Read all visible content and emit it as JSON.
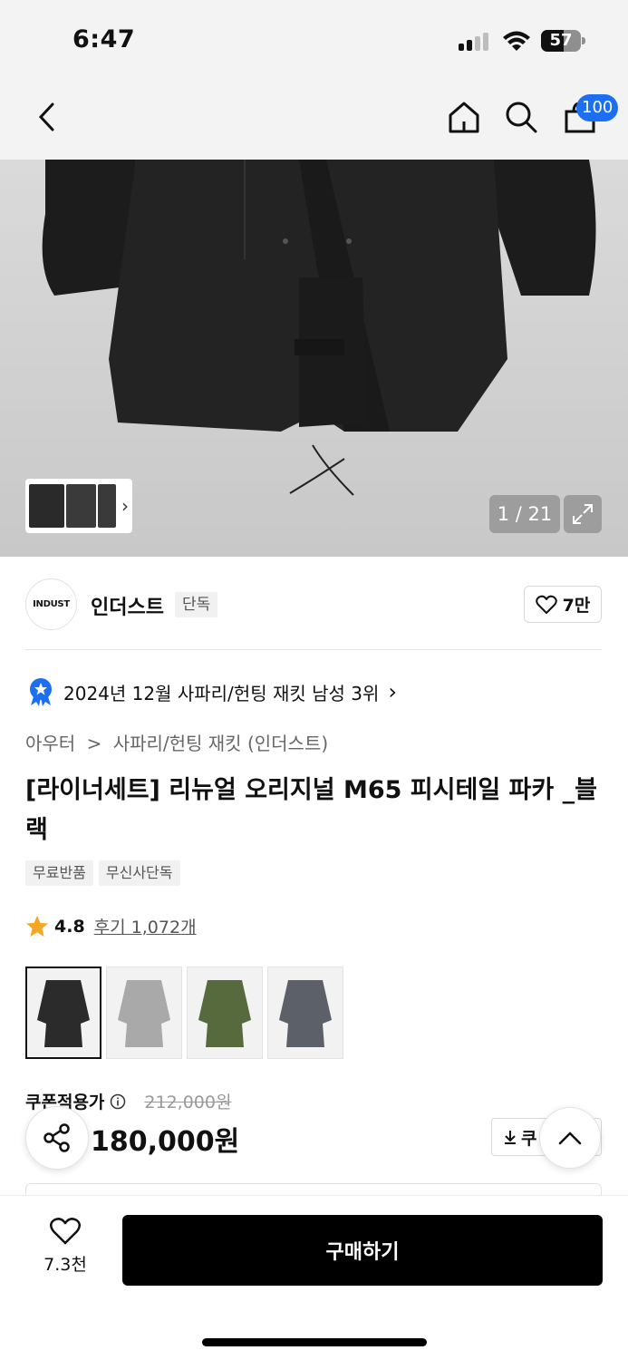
{
  "status": {
    "time": "6:47",
    "battery": "57"
  },
  "nav": {
    "cart_count": "100"
  },
  "hero": {
    "counter": "1 / 21"
  },
  "brand": {
    "logo_text": "INDUST",
    "name": "인더스트",
    "tag": "단독",
    "likes": "7만"
  },
  "rank": {
    "text": "2024년 12월 사파리/헌팅 재킷 남성 3위"
  },
  "breadcrumb": {
    "category": "아우터",
    "sep": ">",
    "sub": "사파리/헌팅 재킷 (인더스트)"
  },
  "product": {
    "title": "[라이너세트] 리뉴얼 오리지널 M65 피시테일 파카 _블랙",
    "chips": [
      "무료반품",
      "무신사단독"
    ],
    "rating": "4.8",
    "reviews": "후기 1,072개",
    "colors": [
      {
        "name": "black",
        "color": "#2b2b2b"
      },
      {
        "name": "gray",
        "color": "#a9a9a9"
      },
      {
        "name": "olive",
        "color": "#566a3e"
      },
      {
        "name": "charcoal",
        "color": "#5c6068"
      }
    ]
  },
  "price": {
    "coupon_label": "쿠폰적용가",
    "original": "212,000원",
    "final": "180,000원",
    "coupon_btn": "쿠"
  },
  "bottom": {
    "wish_count": "7.3천",
    "buy_label": "구매하기"
  },
  "colors": {
    "accent": "#1b6ff0",
    "star": "#f5a623",
    "buy": "#000000"
  }
}
